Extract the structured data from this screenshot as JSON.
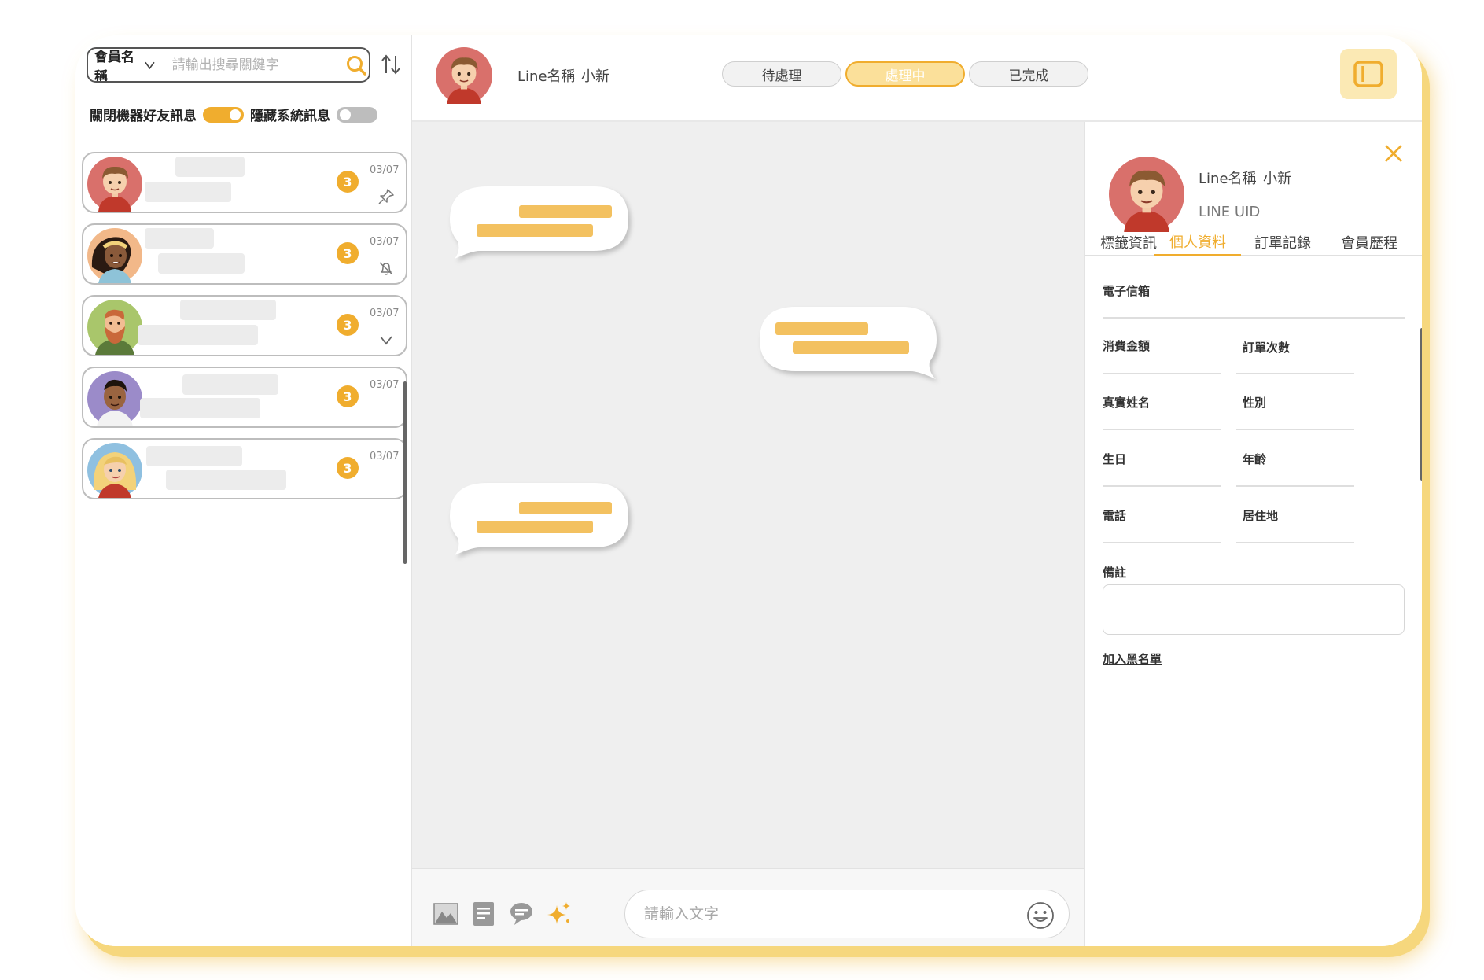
{
  "search": {
    "select_label": "會員名稱",
    "placeholder": "請輸出搜尋關鍵字"
  },
  "filters": {
    "bot_toggle_label": "關閉機器好友訊息",
    "bot_toggle_on": true,
    "system_toggle_label": "隱藏系統訊息",
    "system_toggle_on": false
  },
  "conversations": [
    {
      "date": "03/07",
      "unread": "3",
      "action_icon": "pin-icon"
    },
    {
      "date": "03/07",
      "unread": "3",
      "action_icon": "bell-icon"
    },
    {
      "date": "03/07",
      "unread": "3",
      "action_icon": "chevron-down-icon"
    },
    {
      "date": "03/07",
      "unread": "3",
      "action_icon": ""
    },
    {
      "date": "03/07",
      "unread": "3",
      "action_icon": ""
    }
  ],
  "header": {
    "name_label": "Line名稱",
    "name_value": "小新",
    "status_tabs": [
      {
        "label": "待處理",
        "active": false
      },
      {
        "label": "處理中",
        "active": true
      },
      {
        "label": "已完成",
        "active": false
      }
    ]
  },
  "composer": {
    "placeholder": "請輸入文字",
    "icons": [
      "image-icon",
      "note-icon",
      "chat-bubble-icon",
      "sparkle-icon",
      "emoji-icon"
    ]
  },
  "profile": {
    "name_label": "Line名稱",
    "name_value": "小新",
    "uid_label": "LINE UID",
    "tabs": [
      {
        "label": "標籤資訊",
        "active": false
      },
      {
        "label": "個人資料",
        "active": true
      },
      {
        "label": "訂單記錄",
        "active": false
      },
      {
        "label": "會員歷程",
        "active": false
      }
    ],
    "fields": {
      "email": "電子信箱",
      "spend": "消費金額",
      "order_count": "訂單次數",
      "real_name": "真實姓名",
      "gender": "性別",
      "birthday": "生日",
      "age": "年齡",
      "phone": "電話",
      "residence": "居住地",
      "note": "備註"
    },
    "blacklist_label": "加入黑名單"
  },
  "colors": {
    "accent": "#f0ad2e",
    "skeleton": "#ececec",
    "bubble_bar": "#f3c160",
    "panel_button_bg": "#fbe9b4"
  }
}
